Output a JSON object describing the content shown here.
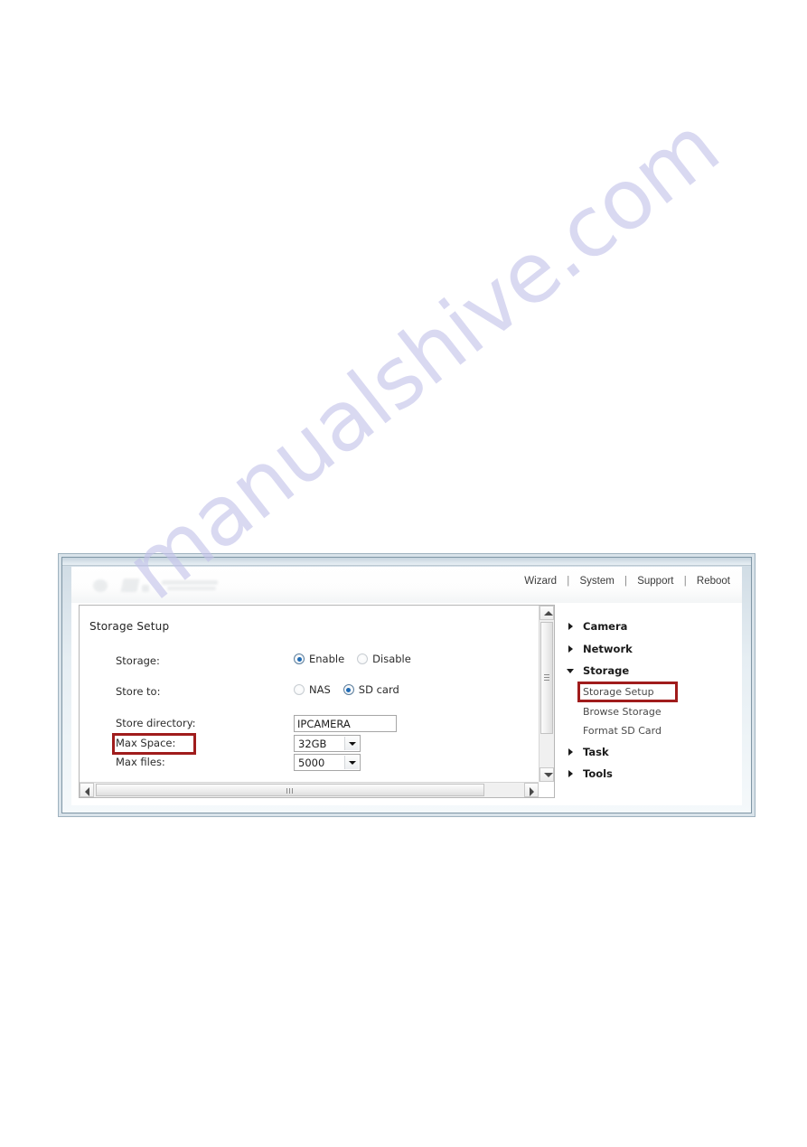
{
  "watermark": {
    "text": "manualshive.com"
  },
  "screenshot": {
    "header": {
      "nav_links": [
        "Wizard",
        "System",
        "Support",
        "Reboot"
      ],
      "separator": "|"
    },
    "content": {
      "title": "Storage Setup",
      "rows": [
        {
          "label": "Storage:",
          "type": "radio",
          "options": [
            {
              "label": "Enable",
              "checked": true
            },
            {
              "label": "Disable",
              "checked": false
            }
          ]
        },
        {
          "label": "Store to:",
          "type": "radio",
          "options": [
            {
              "label": "NAS",
              "checked": false
            },
            {
              "label": "SD card",
              "checked": true
            }
          ]
        },
        {
          "label": "Store directory:",
          "type": "text",
          "value": "IPCAMERA"
        },
        {
          "label": "Max Space:",
          "type": "select",
          "value": "32GB",
          "highlighted": true
        },
        {
          "label": "Max files:",
          "type": "select",
          "value": "5000"
        }
      ]
    },
    "menu": {
      "nodes": [
        {
          "label": "Camera",
          "state": "collapsed",
          "level": "top"
        },
        {
          "label": "Network",
          "state": "collapsed",
          "level": "top"
        },
        {
          "label": "Storage",
          "state": "expanded",
          "level": "top"
        },
        {
          "label": "Storage Setup",
          "level": "child",
          "highlighted": true
        },
        {
          "label": "Browse Storage",
          "level": "child",
          "highlighted": false
        },
        {
          "label": "Format SD Card",
          "level": "child",
          "highlighted": false
        },
        {
          "label": "Task",
          "state": "collapsed",
          "level": "top"
        },
        {
          "label": "Tools",
          "state": "collapsed",
          "level": "top"
        }
      ]
    }
  },
  "colors": {
    "highlight_red": "#a01c1c",
    "radio_blue": "#1f6bb5",
    "watermark_purple": "#c3c2ea",
    "frame_blue_gray": "#9fb2bf"
  }
}
